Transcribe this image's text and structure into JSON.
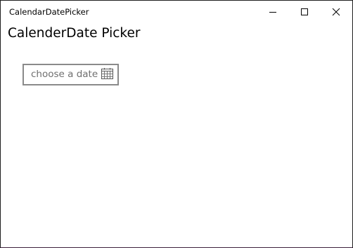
{
  "window": {
    "title": "CalendarDatePicker"
  },
  "caption_buttons": {
    "minimize_icon": "minimize-icon",
    "maximize_icon": "maximize-icon",
    "close_icon": "close-icon"
  },
  "page": {
    "heading": "CalenderDate Picker"
  },
  "date_picker": {
    "placeholder": "choose a date",
    "icon": "calendar-icon"
  },
  "colors": {
    "border": "#8a8a8a",
    "placeholder_text": "#6f6f6f",
    "window_border": "#1f1f1f"
  }
}
